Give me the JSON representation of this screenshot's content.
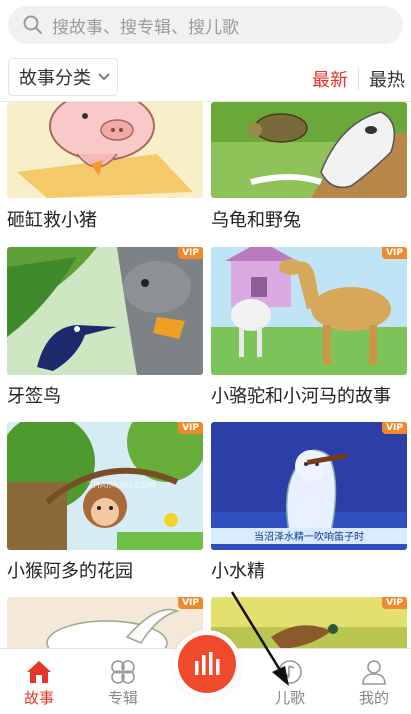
{
  "search": {
    "placeholder": "搜故事、搜专辑、搜儿歌"
  },
  "filter": {
    "category_label": "故事分类",
    "sort_latest": "最新",
    "sort_hot": "最热"
  },
  "cards": [
    {
      "title": "砸缸救小猪",
      "vip": ""
    },
    {
      "title": "乌龟和野兔",
      "vip": ""
    },
    {
      "title": "牙签鸟",
      "vip": "VIP"
    },
    {
      "title": "小骆驼和小河马的故事",
      "vip": "VIP"
    },
    {
      "title": "小猴阿多的花园",
      "vip": "VIP"
    },
    {
      "title": "小水精",
      "vip": "VIP"
    },
    {
      "title": "",
      "vip": "VIP"
    },
    {
      "title": "",
      "vip": "VIP"
    }
  ],
  "card_extra": {
    "watermark": "ZHAIMIAO.COM",
    "banner": "当沼泽水精一吹响笛子时"
  },
  "nav": {
    "tabs": [
      {
        "label": "故事",
        "icon": "home-icon",
        "active": true
      },
      {
        "label": "专辑",
        "icon": "clover-icon",
        "active": false
      },
      {
        "label": "",
        "icon": "sound-bars-icon",
        "active": false
      },
      {
        "label": "儿歌",
        "icon": "music-note-icon",
        "active": false
      },
      {
        "label": "我的",
        "icon": "user-icon",
        "active": false
      }
    ]
  },
  "colors": {
    "accent": "#e5362a",
    "vip": "#f08a2c"
  }
}
